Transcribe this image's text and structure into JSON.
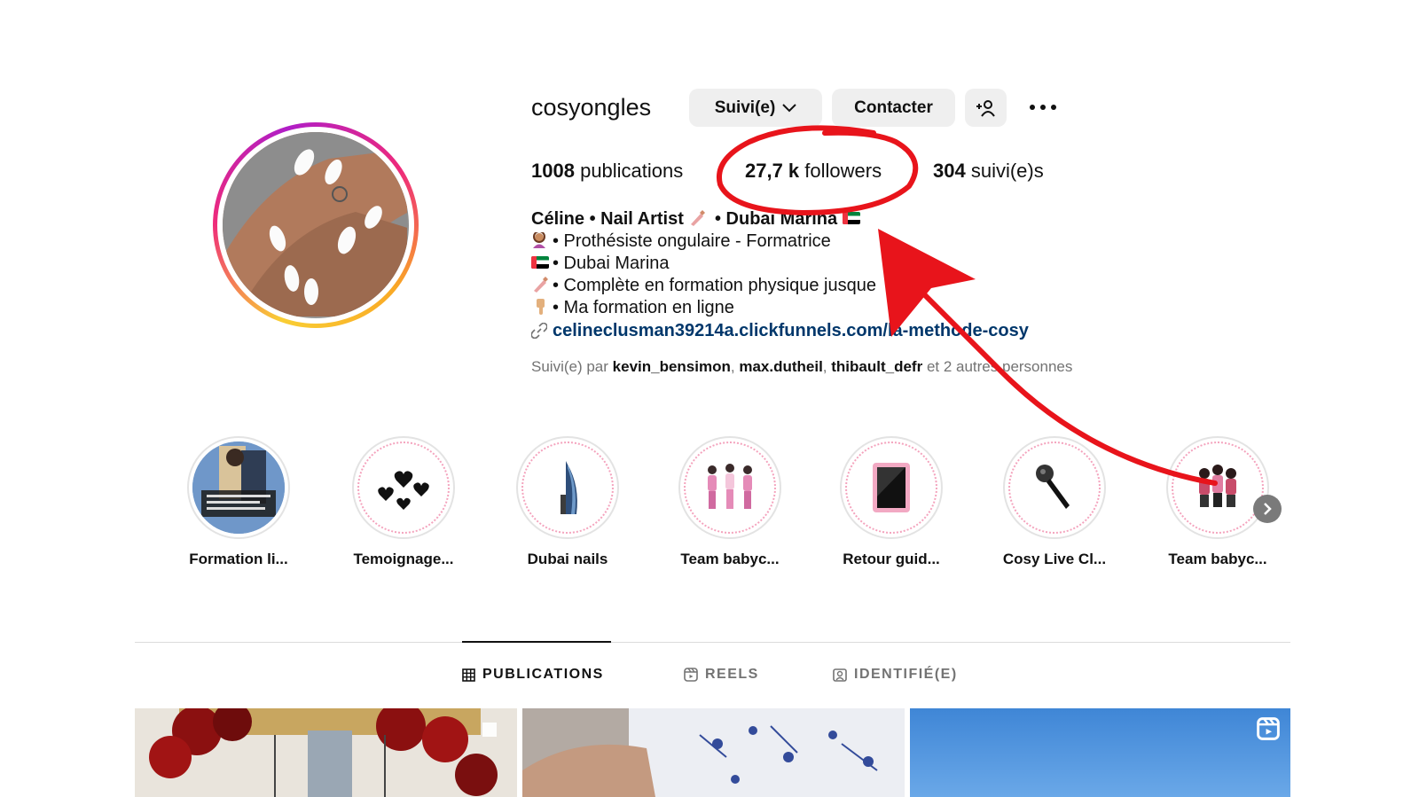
{
  "profile": {
    "username": "cosyongles",
    "follow_label": "Suivi(e)",
    "contact_label": "Contacter",
    "stats": {
      "posts_count": "1008",
      "posts_label": "publications",
      "followers_count": "27,7 k",
      "followers_label": "followers",
      "following_count": "304",
      "following_label": "suivi(e)s"
    },
    "bio": {
      "name_part1": "Céline • Nail Artist",
      "name_part2": "• Dubai Marina",
      "lines": [
        "• Prothésiste ongulaire - Formatrice",
        "• Dubai Marina",
        "• Complète en formation physique jusque",
        "• Ma formation en ligne"
      ],
      "link": "celineclusman39214a.clickfunnels.com/la-methode-cosy"
    },
    "followed_by": {
      "prefix": "Suivi(e) par",
      "user1": "kevin_bensimon",
      "user2": "max.dutheil",
      "user3": "thibault_defr",
      "suffix": "et 2 autres personnes"
    }
  },
  "highlights": [
    {
      "label": "Formation li...",
      "icon": "photo-thumbnail"
    },
    {
      "label": "Temoignage...",
      "icon": "hearts-icon"
    },
    {
      "label": "Dubai nails",
      "icon": "burj-al-arab-icon"
    },
    {
      "label": "Team babyc...",
      "icon": "team-people-icon"
    },
    {
      "label": "Retour guid...",
      "icon": "tablet-icon"
    },
    {
      "label": "Cosy Live Cl...",
      "icon": "microphone-icon"
    },
    {
      "label": "Team babyc...",
      "icon": "team-people-icon"
    }
  ],
  "tabs": [
    {
      "label": "PUBLICATIONS",
      "icon": "grid-icon",
      "active": true
    },
    {
      "label": "REELS",
      "icon": "reels-icon",
      "active": false
    },
    {
      "label": "IDENTIFIÉ(E)",
      "icon": "tagged-icon",
      "active": false
    }
  ],
  "colors": {
    "annotation_red": "#e8141b",
    "link_blue": "#00376b",
    "button_gray": "#efefef",
    "secondary_text": "#737373"
  }
}
